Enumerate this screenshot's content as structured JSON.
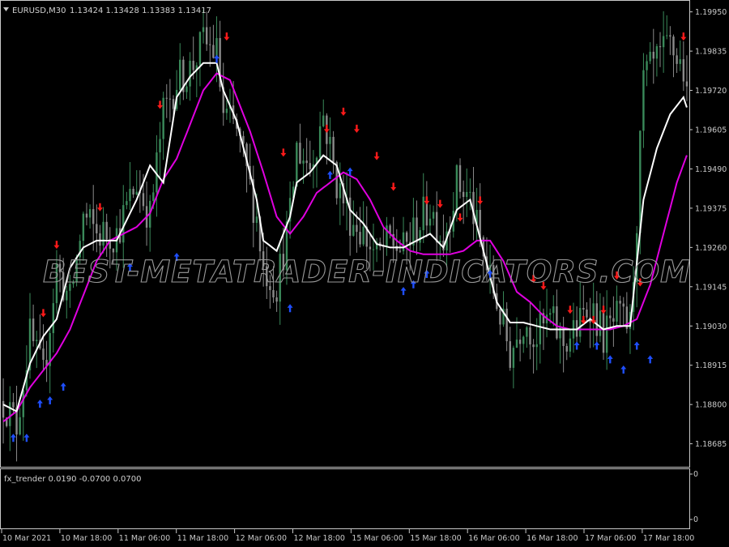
{
  "header": {
    "symbol_timeframe": "EURUSD,M30",
    "ohlc": "1.13424 1.13428 1.13383 1.13417"
  },
  "indicator": {
    "label": "fx_trender 0.0190 -0.0700 0.0700"
  },
  "watermark": "BEST-METATRADER-INDICATORS.COM",
  "colors": {
    "background": "#000000",
    "frame": "#c8c8c8",
    "bull_candle": "#3a8a5a",
    "bear_candle": "#8a8a8a",
    "fast_line": "#ffffff",
    "slow_line": "#e000e0",
    "up_arrow": "#1f4fff",
    "down_arrow": "#ff1a1a"
  },
  "icons": {
    "header_menu": "triangle-down-icon",
    "up_signal": "up-arrow-icon",
    "down_signal": "down-arrow-icon"
  },
  "chart_data": {
    "type": "candlestick",
    "symbol": "EURUSD",
    "timeframe": "M30",
    "ylim": [
      1.1862,
      1.1998
    ],
    "price_ticks": [
      "1.19950",
      "1.19835",
      "1.19720",
      "1.19605",
      "1.19490",
      "1.19375",
      "1.19260",
      "1.19145",
      "1.19030",
      "1.18915",
      "1.18800",
      "1.18685"
    ],
    "time_ticks": [
      "10 Mar 2021",
      "10 Mar 18:00",
      "11 Mar 06:00",
      "11 Mar 18:00",
      "12 Mar 06:00",
      "12 Mar 18:00",
      "15 Mar 06:00",
      "15 Mar 18:00",
      "16 Mar 06:00",
      "16 Mar 18:00",
      "17 Mar 06:00",
      "17 Mar 18:00"
    ],
    "indicator_ticks": [
      "0",
      "0"
    ],
    "close_path": [
      [
        0,
        1.1881
      ],
      [
        4,
        1.1874
      ],
      [
        8,
        1.19
      ],
      [
        12,
        1.1888
      ],
      [
        16,
        1.192
      ],
      [
        20,
        1.191
      ],
      [
        24,
        1.1935
      ],
      [
        28,
        1.193
      ],
      [
        34,
        1.193
      ],
      [
        40,
        1.1945
      ],
      [
        44,
        1.1935
      ],
      [
        48,
        1.1965
      ],
      [
        52,
        1.1975
      ],
      [
        56,
        1.1978
      ],
      [
        60,
        1.1986
      ],
      [
        64,
        1.1983
      ],
      [
        66,
        1.1965
      ],
      [
        70,
        1.196
      ],
      [
        76,
        1.1935
      ],
      [
        78,
        1.192
      ],
      [
        82,
        1.1915
      ],
      [
        86,
        1.1935
      ],
      [
        88,
        1.1955
      ],
      [
        92,
        1.195
      ],
      [
        96,
        1.1965
      ],
      [
        98,
        1.1955
      ],
      [
        100,
        1.1945
      ],
      [
        104,
        1.1935
      ],
      [
        108,
        1.193
      ],
      [
        112,
        1.1923
      ],
      [
        116,
        1.1928
      ],
      [
        120,
        1.1925
      ],
      [
        124,
        1.1932
      ],
      [
        128,
        1.1938
      ],
      [
        132,
        1.1928
      ],
      [
        136,
        1.1945
      ],
      [
        140,
        1.194
      ],
      [
        144,
        1.1923
      ],
      [
        148,
        1.191
      ],
      [
        152,
        1.1895
      ],
      [
        156,
        1.1905
      ],
      [
        160,
        1.19
      ],
      [
        164,
        1.1905
      ],
      [
        168,
        1.1898
      ],
      [
        172,
        1.1902
      ],
      [
        176,
        1.191
      ],
      [
        180,
        1.19
      ],
      [
        184,
        1.1905
      ],
      [
        188,
        1.1903
      ],
      [
        190,
        1.1935
      ],
      [
        192,
        1.1975
      ],
      [
        196,
        1.198
      ],
      [
        200,
        1.1985
      ],
      [
        204,
        1.1978
      ],
      [
        205,
        1.1968
      ]
    ],
    "fast_line": [
      [
        0,
        1.188
      ],
      [
        4,
        1.1878
      ],
      [
        8,
        1.1892
      ],
      [
        12,
        1.19
      ],
      [
        16,
        1.1905
      ],
      [
        20,
        1.192
      ],
      [
        24,
        1.1926
      ],
      [
        28,
        1.1928
      ],
      [
        34,
        1.1928
      ],
      [
        40,
        1.194
      ],
      [
        44,
        1.195
      ],
      [
        48,
        1.1945
      ],
      [
        52,
        1.197
      ],
      [
        56,
        1.1976
      ],
      [
        60,
        1.198
      ],
      [
        64,
        1.198
      ],
      [
        66,
        1.1972
      ],
      [
        70,
        1.1963
      ],
      [
        76,
        1.194
      ],
      [
        78,
        1.1928
      ],
      [
        82,
        1.1925
      ],
      [
        86,
        1.1935
      ],
      [
        88,
        1.1945
      ],
      [
        92,
        1.1948
      ],
      [
        96,
        1.1953
      ],
      [
        100,
        1.195
      ],
      [
        104,
        1.1937
      ],
      [
        108,
        1.1933
      ],
      [
        112,
        1.1927
      ],
      [
        116,
        1.1926
      ],
      [
        120,
        1.1926
      ],
      [
        124,
        1.1928
      ],
      [
        128,
        1.193
      ],
      [
        132,
        1.1926
      ],
      [
        136,
        1.1937
      ],
      [
        140,
        1.194
      ],
      [
        144,
        1.1925
      ],
      [
        148,
        1.191
      ],
      [
        152,
        1.1904
      ],
      [
        156,
        1.1904
      ],
      [
        160,
        1.1903
      ],
      [
        164,
        1.1902
      ],
      [
        168,
        1.1902
      ],
      [
        172,
        1.1902
      ],
      [
        176,
        1.1905
      ],
      [
        180,
        1.1902
      ],
      [
        184,
        1.1903
      ],
      [
        188,
        1.1903
      ],
      [
        192,
        1.194
      ],
      [
        196,
        1.1955
      ],
      [
        200,
        1.1965
      ],
      [
        204,
        1.197
      ],
      [
        205,
        1.1967
      ]
    ],
    "slow_line": [
      [
        0,
        1.1875
      ],
      [
        4,
        1.1878
      ],
      [
        8,
        1.1885
      ],
      [
        12,
        1.189
      ],
      [
        16,
        1.1895
      ],
      [
        20,
        1.1902
      ],
      [
        24,
        1.1912
      ],
      [
        28,
        1.1922
      ],
      [
        32,
        1.1928
      ],
      [
        36,
        1.193
      ],
      [
        40,
        1.1932
      ],
      [
        44,
        1.1936
      ],
      [
        48,
        1.1946
      ],
      [
        52,
        1.1952
      ],
      [
        56,
        1.1962
      ],
      [
        60,
        1.1972
      ],
      [
        64,
        1.1977
      ],
      [
        68,
        1.1975
      ],
      [
        70,
        1.197
      ],
      [
        74,
        1.196
      ],
      [
        78,
        1.1948
      ],
      [
        82,
        1.1935
      ],
      [
        86,
        1.193
      ],
      [
        90,
        1.1935
      ],
      [
        94,
        1.1942
      ],
      [
        98,
        1.1945
      ],
      [
        102,
        1.1948
      ],
      [
        106,
        1.1946
      ],
      [
        110,
        1.194
      ],
      [
        114,
        1.1932
      ],
      [
        118,
        1.1928
      ],
      [
        122,
        1.1925
      ],
      [
        126,
        1.1924
      ],
      [
        130,
        1.1924
      ],
      [
        134,
        1.1924
      ],
      [
        138,
        1.1925
      ],
      [
        142,
        1.1928
      ],
      [
        146,
        1.1928
      ],
      [
        150,
        1.1922
      ],
      [
        154,
        1.1913
      ],
      [
        158,
        1.191
      ],
      [
        162,
        1.1906
      ],
      [
        166,
        1.1903
      ],
      [
        170,
        1.1902
      ],
      [
        174,
        1.1902
      ],
      [
        178,
        1.1902
      ],
      [
        182,
        1.1902
      ],
      [
        186,
        1.1903
      ],
      [
        190,
        1.1905
      ],
      [
        194,
        1.1915
      ],
      [
        198,
        1.193
      ],
      [
        202,
        1.1945
      ],
      [
        205,
        1.1953
      ]
    ],
    "up_arrows": [
      [
        3,
        1.187
      ],
      [
        7,
        1.187
      ],
      [
        11,
        1.188
      ],
      [
        14,
        1.1881
      ],
      [
        18,
        1.1885
      ],
      [
        38,
        1.192
      ],
      [
        52,
        1.1923
      ],
      [
        64,
        1.1981
      ],
      [
        86,
        1.1908
      ],
      [
        98,
        1.1947
      ],
      [
        104,
        1.1948
      ],
      [
        120,
        1.1913
      ],
      [
        123,
        1.1915
      ],
      [
        127,
        1.1918
      ],
      [
        146,
        1.1918
      ],
      [
        172,
        1.1897
      ],
      [
        178,
        1.1897
      ],
      [
        182,
        1.1893
      ],
      [
        186,
        1.189
      ],
      [
        190,
        1.1897
      ],
      [
        194,
        1.1893
      ]
    ],
    "down_arrows": [
      [
        12,
        1.1907
      ],
      [
        16,
        1.1927
      ],
      [
        29,
        1.1938
      ],
      [
        47,
        1.1968
      ],
      [
        67,
        1.1988
      ],
      [
        84,
        1.1954
      ],
      [
        97,
        1.1961
      ],
      [
        102,
        1.1966
      ],
      [
        106,
        1.1961
      ],
      [
        112,
        1.1953
      ],
      [
        117,
        1.1944
      ],
      [
        127,
        1.194
      ],
      [
        131,
        1.1939
      ],
      [
        137,
        1.1935
      ],
      [
        143,
        1.194
      ],
      [
        159,
        1.1917
      ],
      [
        162,
        1.1915
      ],
      [
        170,
        1.1908
      ],
      [
        174,
        1.1905
      ],
      [
        177,
        1.1905
      ],
      [
        180,
        1.1908
      ],
      [
        184,
        1.1918
      ],
      [
        191,
        1.1916
      ],
      [
        204,
        1.1988
      ]
    ]
  }
}
